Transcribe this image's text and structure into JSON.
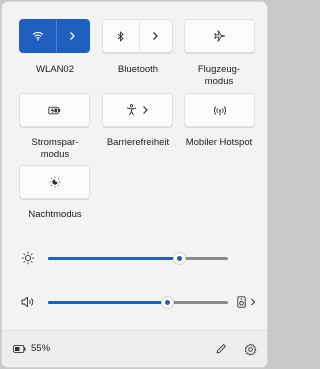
{
  "quick_settings": {
    "tiles": [
      {
        "label": "WLAN02",
        "icon": "wifi-icon",
        "active": true
      },
      {
        "label": "Bluetooth",
        "icon": "bluetooth-icon",
        "active": false
      },
      {
        "label": "Flugzeug-\nmodus",
        "icon": "airplane-icon",
        "active": false
      },
      {
        "label": "Stromspar-\nmodus",
        "icon": "battery-saver-icon",
        "active": false
      },
      {
        "label": "Barrierefreiheit",
        "icon": "accessibility-icon",
        "active": false
      },
      {
        "label": "Mobiler Hotspot",
        "icon": "hotspot-icon",
        "active": false
      },
      {
        "label": "Nachtmodus",
        "icon": "night-light-icon",
        "active": false
      }
    ]
  },
  "sliders": {
    "brightness": {
      "icon": "brightness-icon",
      "value": 0.73
    },
    "volume": {
      "icon": "speaker-icon",
      "value": 0.66,
      "output_icon": "audio-output-icon"
    }
  },
  "footer": {
    "battery_percent": "55%",
    "battery_icon": "battery-icon",
    "edit_icon": "pencil-icon",
    "settings_icon": "gear-icon"
  },
  "colors": {
    "accent": "#1f5fc0",
    "panel": "#f3f3f3"
  }
}
